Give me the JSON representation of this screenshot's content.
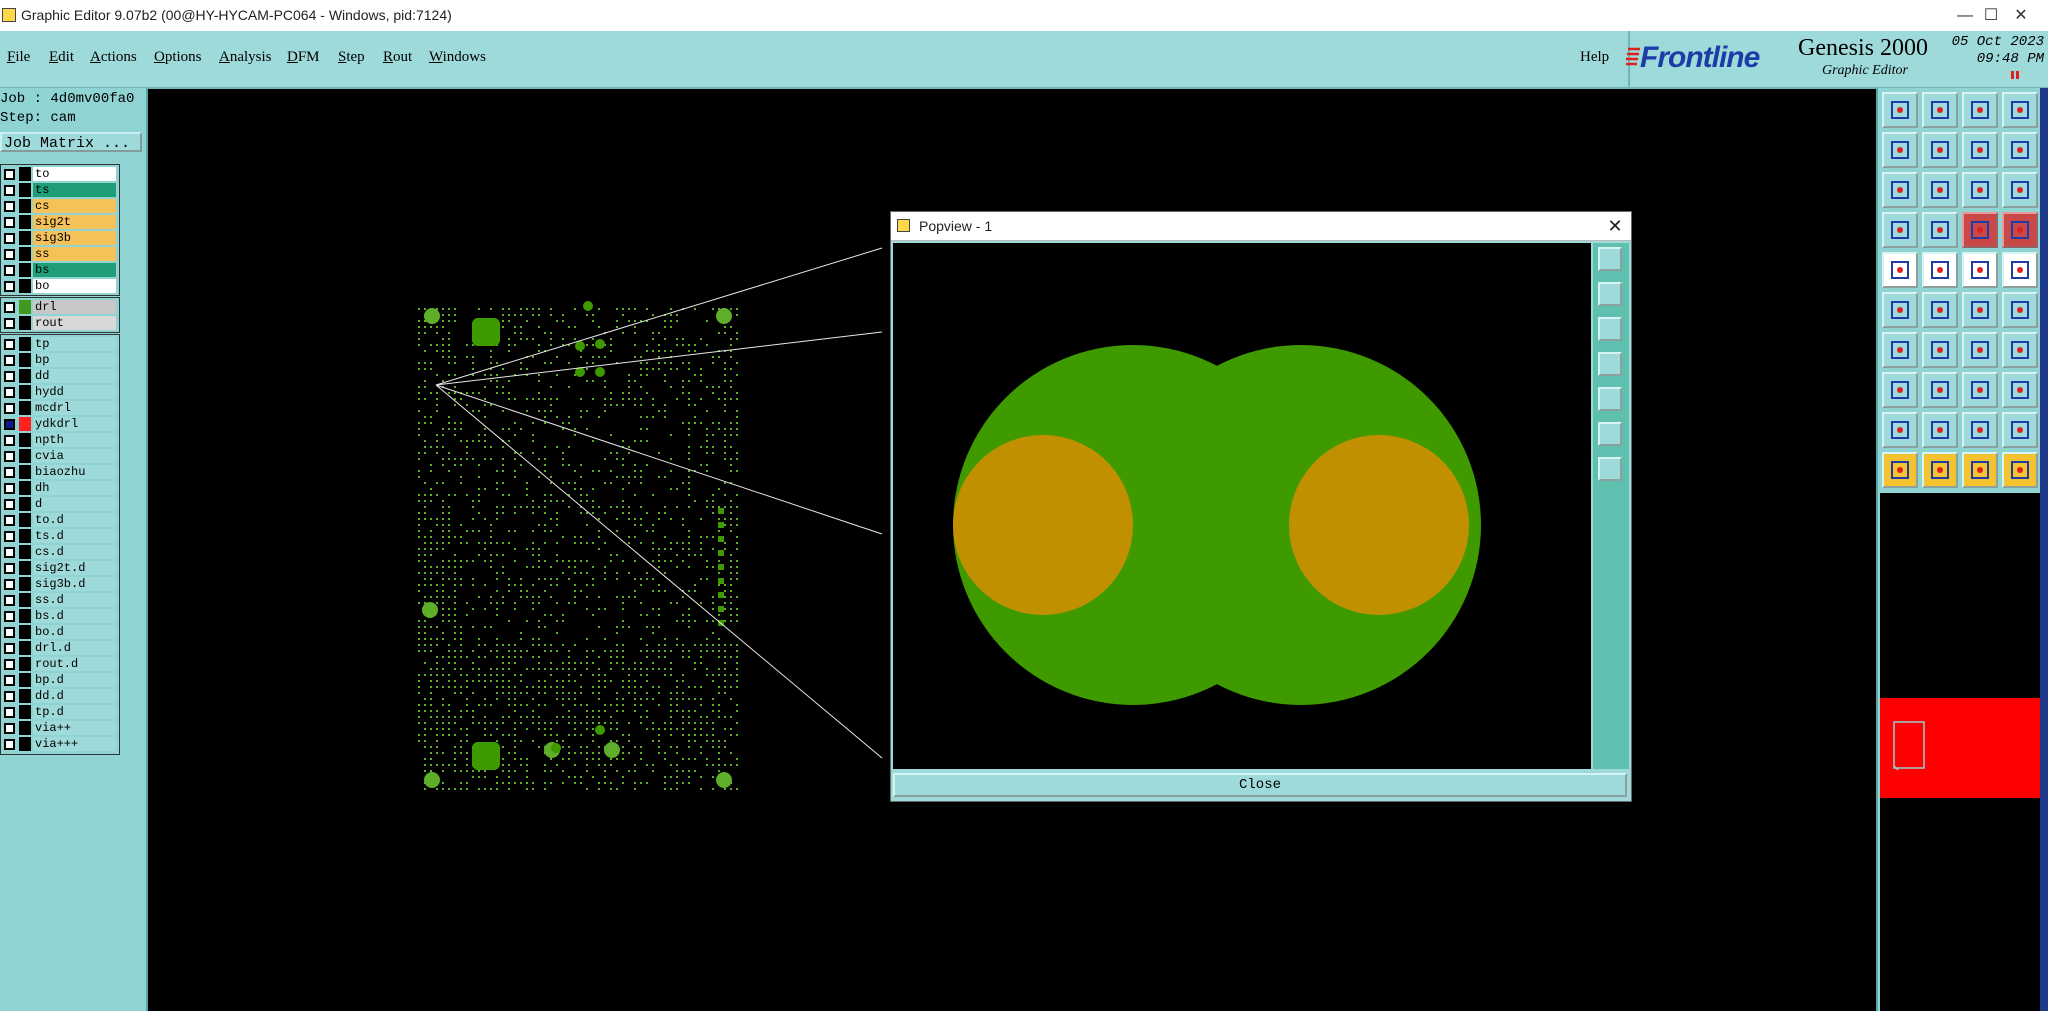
{
  "window": {
    "title": "Graphic Editor 9.07b2 (00@HY-HYCAM-PC064 - Windows, pid:7124)",
    "controls": [
      "—",
      "☐",
      "✕"
    ]
  },
  "menu": {
    "items": [
      "File",
      "Edit",
      "Actions",
      "Options",
      "Analysis",
      "DFM",
      "Step",
      "Rout",
      "Windows"
    ],
    "help": "Help"
  },
  "branding": {
    "logo": "Frontline",
    "product": "Genesis 2000",
    "subtitle": "Graphic Editor",
    "date_line1": "05 Oct 2023",
    "date_line2": "09:48 PM"
  },
  "job": {
    "job_line": "Job : 4d0mv00fa0",
    "step_line": "Step: cam",
    "matrix_button": "Job Matrix ..."
  },
  "layers": {
    "board": [
      {
        "name": "to",
        "color": "#ffffff",
        "checked": false
      },
      {
        "name": "ts",
        "color": "#1f9e78",
        "checked": false
      },
      {
        "name": "cs",
        "color": "#f5c25a",
        "checked": false
      },
      {
        "name": "sig2t",
        "color": "#f5c25a",
        "checked": false
      },
      {
        "name": "sig3b",
        "color": "#f5c25a",
        "checked": false
      },
      {
        "name": "ss",
        "color": "#f5c25a",
        "checked": false
      },
      {
        "name": "bs",
        "color": "#1f9e78",
        "checked": false
      },
      {
        "name": "bo",
        "color": "#ffffff",
        "checked": false
      }
    ],
    "drill": [
      {
        "name": "drl",
        "color": "#c8c8c8",
        "swatch": "#3f9a1e",
        "checked": false
      },
      {
        "name": "rout",
        "color": "#d8d8d8",
        "checked": false
      }
    ],
    "misc": [
      {
        "name": "tp",
        "checked": false
      },
      {
        "name": "bp",
        "checked": false
      },
      {
        "name": "dd",
        "checked": false
      },
      {
        "name": "hydd",
        "checked": false
      },
      {
        "name": "mcdrl",
        "checked": false
      },
      {
        "name": "ydkdrl",
        "checked": true,
        "swatch": "#ff2020"
      },
      {
        "name": "npth",
        "checked": false
      },
      {
        "name": "cvia",
        "checked": false
      },
      {
        "name": "biaozhu",
        "checked": false
      },
      {
        "name": "dh",
        "checked": false
      },
      {
        "name": "d",
        "checked": false
      },
      {
        "name": "to.d",
        "checked": false
      },
      {
        "name": "ts.d",
        "checked": false
      },
      {
        "name": "cs.d",
        "checked": false
      },
      {
        "name": "sig2t.d",
        "checked": false
      },
      {
        "name": "sig3b.d",
        "checked": false
      },
      {
        "name": "ss.d",
        "checked": false
      },
      {
        "name": "bs.d",
        "checked": false
      },
      {
        "name": "bo.d",
        "checked": false
      },
      {
        "name": "drl.d",
        "checked": false
      },
      {
        "name": "rout.d",
        "checked": false
      },
      {
        "name": "bp.d",
        "checked": false
      },
      {
        "name": "dd.d",
        "checked": false
      },
      {
        "name": "tp.d",
        "checked": false
      },
      {
        "name": "via++",
        "checked": false
      },
      {
        "name": "via+++",
        "checked": false
      }
    ]
  },
  "popview": {
    "title": "Popview - 1",
    "close_x": "✕",
    "close_label": "Close",
    "tools": [
      "zoom-fit-icon",
      "pan-up-icon",
      "pan-down-icon",
      "pan-left-icon",
      "pan-right-icon",
      "zoom-in-icon",
      "zoom-out-icon"
    ]
  },
  "colors": {
    "panel": "#8fd3d3",
    "pad_green": "#3f9a00",
    "drill_gold": "#c09000",
    "board_green": "#5fae2a"
  }
}
